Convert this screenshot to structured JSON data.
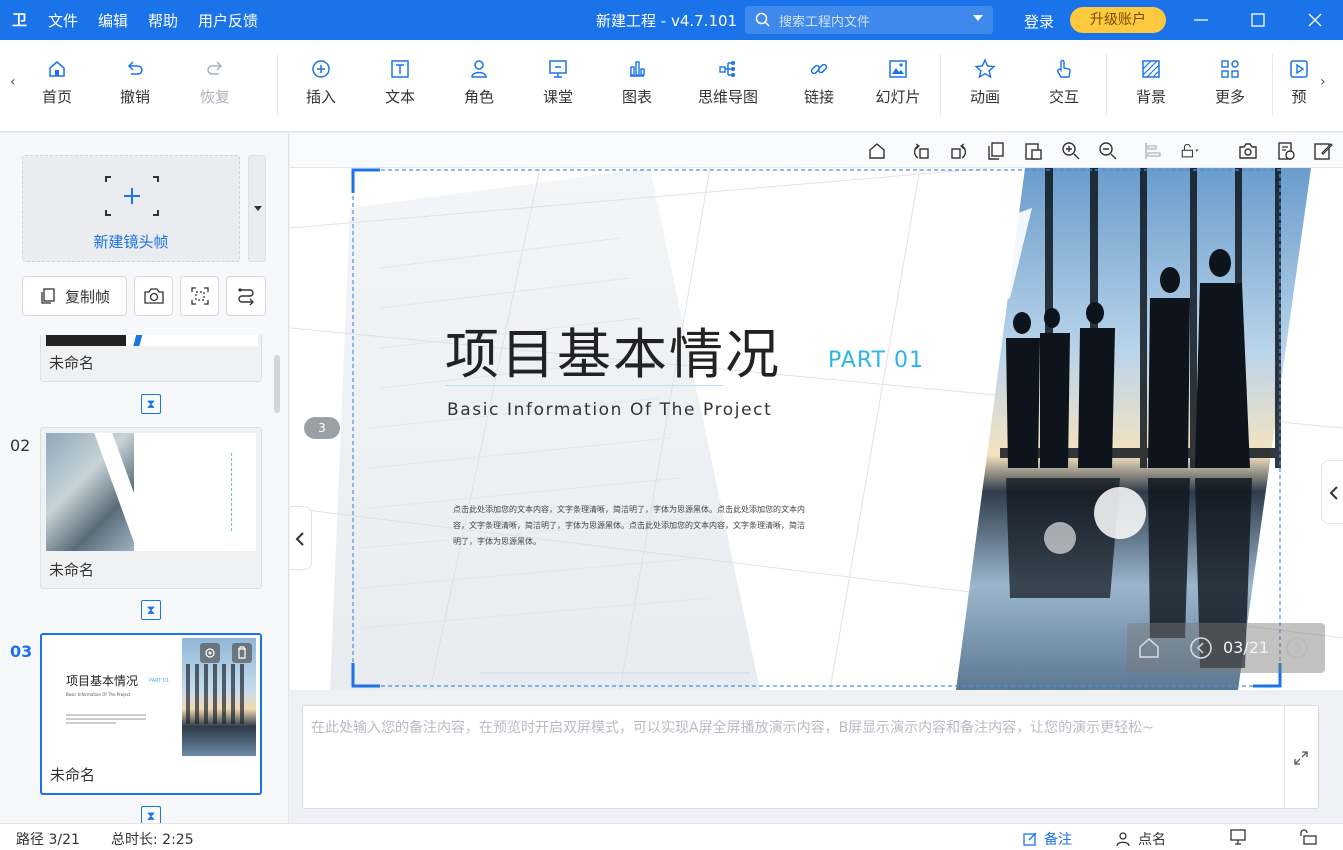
{
  "titlebar": {
    "logo": "卫",
    "menu": [
      "文件",
      "编辑",
      "帮助",
      "用户反馈"
    ],
    "app_title": "新建工程 - v4.7.101",
    "search_placeholder": "搜索工程内文件",
    "login": "登录",
    "upgrade": "升级账户",
    "accent_color": "#1a73e8"
  },
  "toolbar": {
    "items": [
      {
        "label": "首页",
        "icon": "home-icon"
      },
      {
        "label": "撤销",
        "icon": "undo-icon"
      },
      {
        "label": "恢复",
        "icon": "redo-icon"
      },
      {
        "label": "插入",
        "icon": "plus-circle-icon"
      },
      {
        "label": "文本",
        "icon": "text-box-icon"
      },
      {
        "label": "角色",
        "icon": "person-icon"
      },
      {
        "label": "课堂",
        "icon": "presentation-board-icon"
      },
      {
        "label": "图表",
        "icon": "bar-chart-icon"
      },
      {
        "label": "思维导图",
        "icon": "mindmap-icon"
      },
      {
        "label": "链接",
        "icon": "link-icon"
      },
      {
        "label": "幻灯片",
        "icon": "image-slide-icon"
      },
      {
        "label": "动画",
        "icon": "star-icon"
      },
      {
        "label": "交互",
        "icon": "hand-pointer-icon"
      },
      {
        "label": "背景",
        "icon": "background-icon"
      },
      {
        "label": "更多",
        "icon": "grid-more-icon"
      },
      {
        "label": "预",
        "icon": "preview-icon"
      }
    ]
  },
  "left": {
    "new_frame": "新建镜头帧",
    "copy_frame": "复制帧",
    "slides": [
      {
        "num": "",
        "name": "未命名"
      },
      {
        "num": "02",
        "name": "未命名"
      },
      {
        "num": "03",
        "name": "未命名"
      }
    ]
  },
  "slide": {
    "title": "项目基本情况",
    "part": "PART 01",
    "subtitle": "Basic Information Of The Project",
    "body": "点击此处添加您的文本内容，文字条理清晰，简洁明了，字体为思源黑体。点击此处添加您的文本内容，文字条理清晰，简洁明了，字体为思源黑体。点击此处添加您的文本内容，文字条理清晰，简洁明了，字体为思源黑体。",
    "thumb_title": "项目基本情况",
    "thumb_part": "PART 01",
    "thumb_sub": "Basic Information Of The Project",
    "path_badge": "3",
    "nav_counter": "03/21"
  },
  "notes": {
    "placeholder": "在此处输入您的备注内容，在预览时开启双屏模式，可以实现A屏全屏播放演示内容，B屏显示演示内容和备注内容，让您的演示更轻松~"
  },
  "status": {
    "path": "路径 3/21",
    "duration": "总时长: 2:25",
    "notes_btn": "备注",
    "rollcall_btn": "点名"
  }
}
